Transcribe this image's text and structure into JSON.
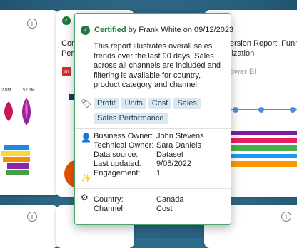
{
  "background_cards": {
    "card2": {
      "title_lines": [
        "Con",
        "Perf"
      ]
    },
    "card3": {
      "title_lines": [
        "ersion Report: Funne",
        "lization"
      ],
      "subtitle": "ower BI"
    },
    "card1_values": [
      "2.8M",
      "$2.3M"
    ]
  },
  "popup": {
    "certified_label": "Certified",
    "certified_by": " by Frank White on 09/12/2023",
    "description": "This report illustrates overall sales trends over the last 90 days. Sales across all channels are included and filtering is available for country, product category and channel.",
    "tags": [
      "Profit",
      "Units",
      "Cost",
      "Sales",
      "Sales Performance"
    ],
    "owners": [
      {
        "key": "Business Owner:",
        "value": "John Stevens"
      },
      {
        "key": "Technical Owner:",
        "value": "Sara Daniels"
      },
      {
        "key": "Data source:",
        "value": "Dataset"
      },
      {
        "key": "Last updated:",
        "value": "9/05/2022"
      },
      {
        "key": "Engagement:",
        "value": "1"
      }
    ],
    "filters": [
      {
        "key": "Country:",
        "value": "Canada"
      },
      {
        "key": "Channel:",
        "value": "Cost"
      }
    ]
  },
  "colors": {
    "certified_green": "#1f7a3d",
    "tag_bg": "#dbe8f0",
    "page_bg": "#2f6b8a"
  }
}
